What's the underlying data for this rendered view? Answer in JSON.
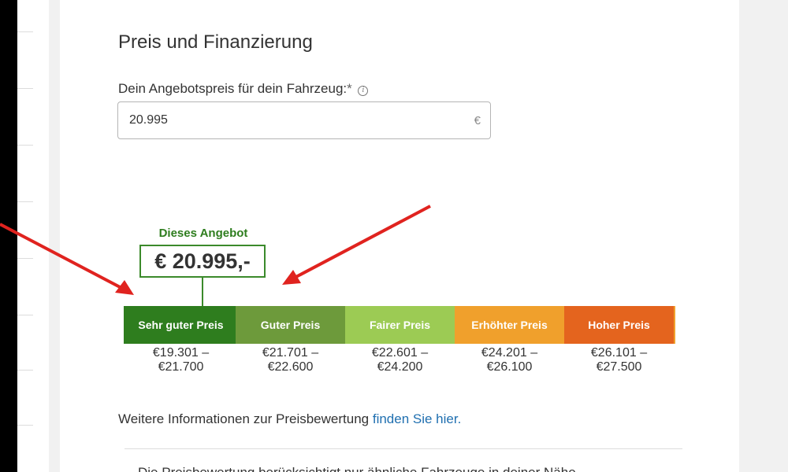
{
  "section": {
    "title": "Preis und Finanzierung"
  },
  "price_field": {
    "label": "Dein Angebotspreis für dein Fahrzeug:",
    "required_mark": "*",
    "info_glyph": "i",
    "value": "20.995",
    "currency": "€"
  },
  "offer": {
    "label": "Dieses Angebot",
    "price": "€ 20.995,-"
  },
  "rating": {
    "segments": [
      {
        "label": "Sehr guter Preis",
        "color": "#2e7d1e",
        "range_line1": "€19.301 –",
        "range_line2": "€21.700"
      },
      {
        "label": "Guter Preis",
        "color": "#6d9a3b",
        "range_line1": "€21.701 –",
        "range_line2": "€22.600"
      },
      {
        "label": "Fairer Preis",
        "color": "#9ccb54",
        "range_line1": "€22.601 –",
        "range_line2": "€24.200"
      },
      {
        "label": "Erhöhter Preis",
        "color": "#f0a02c",
        "range_line1": "€24.201 –",
        "range_line2": "€26.100"
      },
      {
        "label": "Hoher Preis",
        "color": "#e4641e",
        "range_line1": "€26.101 –",
        "range_line2": "€27.500"
      }
    ]
  },
  "more_info": {
    "text": "Weitere Informationen zur Preisbewertung ",
    "link": "finden Sie hier."
  },
  "cut_text": "Die Preisbewertung berücksichtigt nur ähnliche Fahrzeuge in deiner Nähe",
  "colors": {
    "annotation_arrow": "#e0231f",
    "link": "#1f6fb0",
    "offer_border": "#3b8a2b"
  }
}
